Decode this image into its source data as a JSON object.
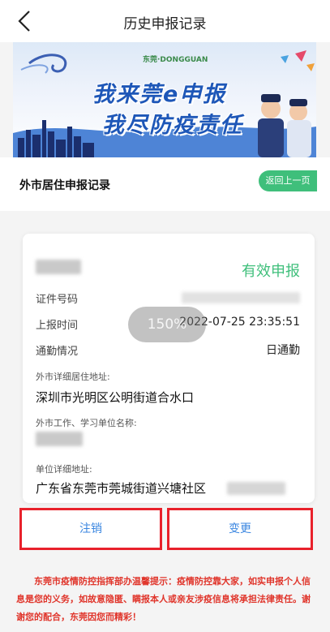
{
  "header": {
    "title": "历史申报记录"
  },
  "banner": {
    "slogan_line1": "我来莞e申报",
    "slogan_line2": "我尽防疫责任",
    "logo_text": "东莞·DONGGUAN"
  },
  "section": {
    "title": "外市居住申报记录",
    "back_label": "返回上一页"
  },
  "record": {
    "status": "有效申报",
    "id_label": "证件号码",
    "report_time_label": "上报时间",
    "report_time_value": "2022-07-25 23:35:51",
    "commute_label": "通勤情况",
    "commute_value": "日通勤",
    "home_address_label": "外市详细居住地址:",
    "home_address_value": "深圳市光明区公明街道合水口",
    "work_unit_label": "外市工作、学习单位名称:",
    "unit_address_label": "单位详细地址:",
    "unit_address_value": "广东省东莞市莞城街道兴塘社区"
  },
  "zoom": {
    "label": "150%"
  },
  "actions": {
    "cancel_label": "注销",
    "change_label": "变更"
  },
  "notice": {
    "text": "东莞市疫情防控指挥部办温馨提示：疫情防控靠大家，如实申报个人信息是您的义务，如故意隐匿、瞒报本人或亲友涉疫信息将承担法律责任。谢谢您的配合，东莞因您而精彩！"
  },
  "colors": {
    "accent_green": "#3fbf7b",
    "highlight_red": "#e8212b",
    "link_blue": "#3a86e0",
    "notice_red": "#e0352b"
  }
}
